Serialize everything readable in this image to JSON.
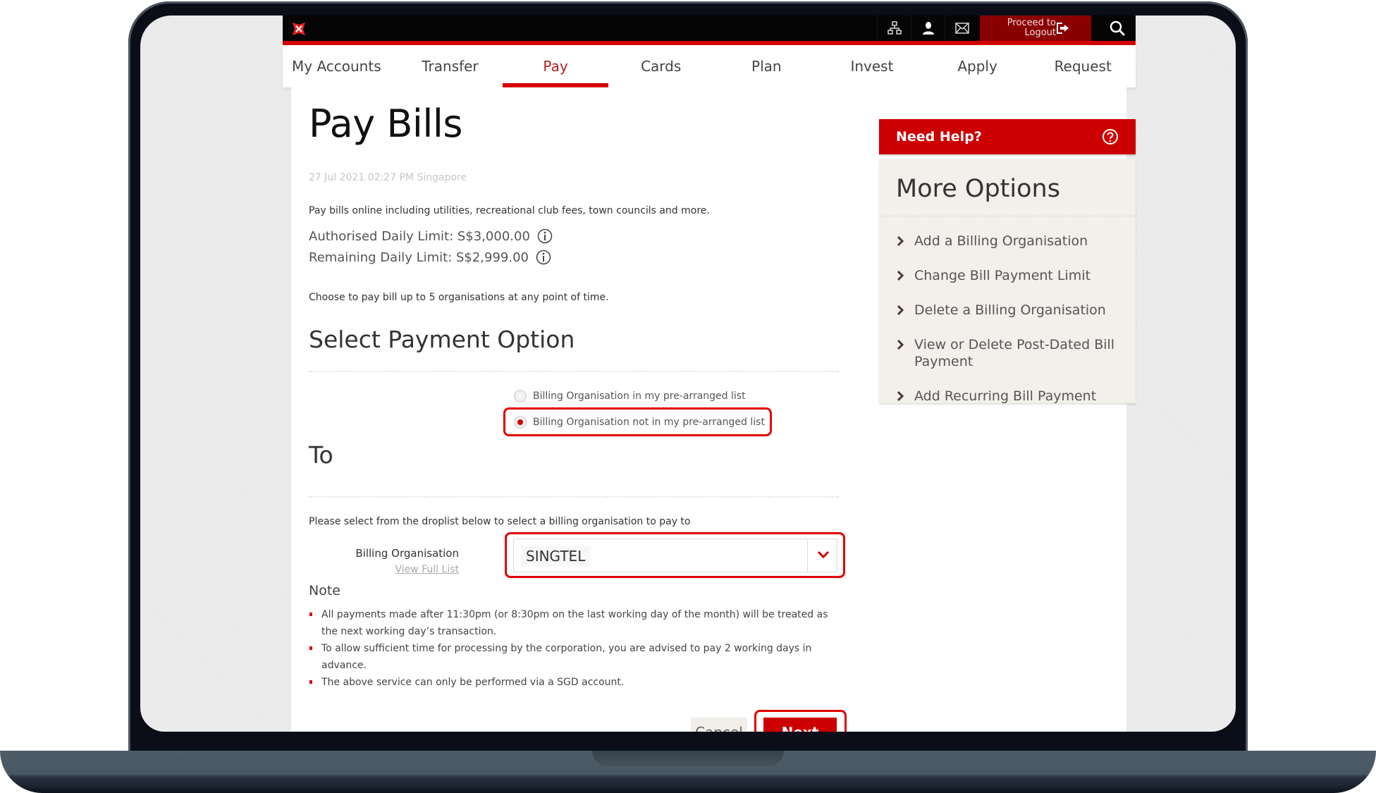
{
  "header": {
    "logo": "dbs-star-logo",
    "icons": [
      "sitemap-icon",
      "user-icon",
      "mail-icon"
    ],
    "logout_label_line1": "Proceed to",
    "logout_label_line2": "Logout",
    "search": "search-icon"
  },
  "nav": {
    "tabs": [
      {
        "label": "My Accounts",
        "active": false
      },
      {
        "label": "Transfer",
        "active": false
      },
      {
        "label": "Pay",
        "active": true
      },
      {
        "label": "Cards",
        "active": false
      },
      {
        "label": "Plan",
        "active": false
      },
      {
        "label": "Invest",
        "active": false
      },
      {
        "label": "Apply",
        "active": false
      },
      {
        "label": "Request",
        "active": false
      }
    ]
  },
  "main": {
    "title": "Pay Bills",
    "timestamp": "27 Jul 2021 02:27 PM Singapore",
    "intro": "Pay bills online including utilities, recreational club fees, town councils and more.",
    "authorised_limit": "Authorised Daily Limit: S$3,000.00",
    "remaining_limit": "Remaining Daily Limit: S$2,999.00",
    "choose_text": "Choose to pay bill up to 5 organisations at any point of time.",
    "payment_option_heading": "Select Payment Option",
    "radio_options": [
      {
        "label": "Billing Organisation in my pre-arranged list",
        "checked": false
      },
      {
        "label": "Billing Organisation not in my pre-arranged list",
        "checked": true
      }
    ],
    "to_heading": "To",
    "droplist_help": "Please select from the droplist below to select a billing organisation to pay to",
    "billing_org_label": "Billing Organisation",
    "view_full_list": "View Full List",
    "billing_org_value": "SINGTEL",
    "note_heading": "Note",
    "notes": [
      "All payments made after 11:30pm (or 8:30pm on the last working day of the month) will be treated as the next working day’s transaction.",
      "To allow sufficient time for processing by the corporation, you are advised to pay 2 working days in advance.",
      "The above service can only be performed via a SGD account."
    ],
    "cancel_label": "Cancel",
    "next_label": "Next"
  },
  "sidebar": {
    "help_label": "Need Help?",
    "options_title": "More Options",
    "options": [
      "Add a Billing Organisation",
      "Change Bill Payment Limit",
      "Delete a Billing Organisation",
      "View or Delete Post-Dated Bill Payment",
      "Add Recurring Bill Payment"
    ]
  },
  "colors": {
    "brand_red": "#cc0000",
    "logout_bg": "#8a0000",
    "header_bg": "#050505",
    "panel_bg": "#f3f0eb",
    "highlight": "#e00000"
  }
}
